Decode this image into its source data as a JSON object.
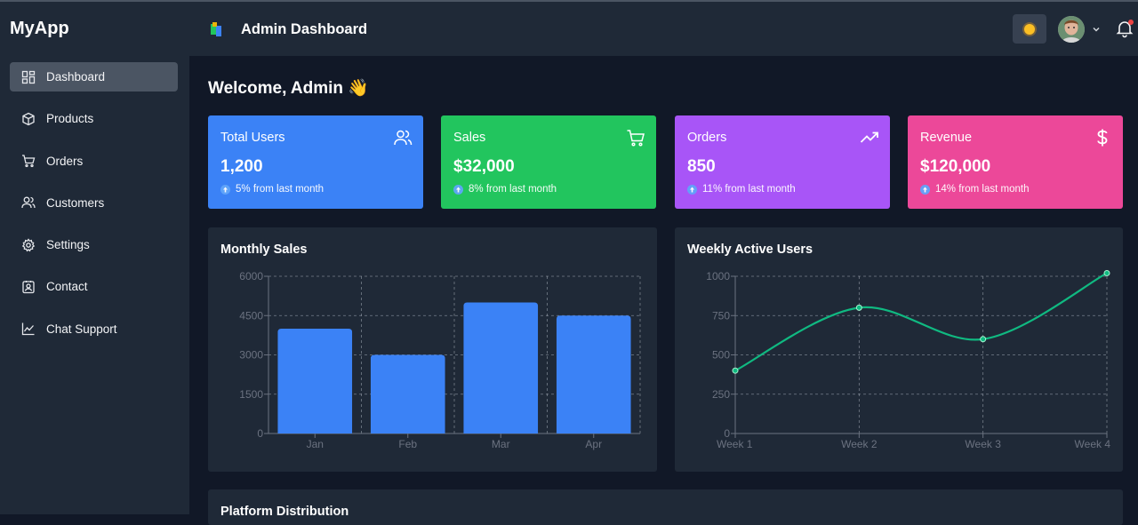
{
  "app": {
    "brand": "MyApp"
  },
  "sidebar": {
    "items": [
      {
        "label": "Dashboard",
        "icon": "dashboard-icon",
        "active": true
      },
      {
        "label": "Products",
        "icon": "box-icon"
      },
      {
        "label": "Orders",
        "icon": "cart-icon"
      },
      {
        "label": "Customers",
        "icon": "users-icon"
      },
      {
        "label": "Settings",
        "icon": "gear-icon"
      },
      {
        "label": "Contact",
        "icon": "contact-card-icon"
      },
      {
        "label": "Chat Support",
        "icon": "chart-line-icon"
      }
    ]
  },
  "header": {
    "title": "Admin Dashboard"
  },
  "main": {
    "welcome": "Welcome, Admin",
    "welcome_emoji": "👋",
    "stats": [
      {
        "title": "Total Users",
        "value": "1,200",
        "change": "5% from last month",
        "color": "#3b82f6",
        "icon": "users-icon"
      },
      {
        "title": "Sales",
        "value": "$32,000",
        "change": "8% from last month",
        "color": "#22c55e",
        "icon": "cart-icon"
      },
      {
        "title": "Orders",
        "value": "850",
        "change": "11% from last month",
        "color": "#a855f7",
        "icon": "trending-up-icon"
      },
      {
        "title": "Revenue",
        "value": "$120,000",
        "change": "14% from last month",
        "color": "#ec4899",
        "icon": "dollar-icon"
      }
    ],
    "bottom_panel_title": "Platform Distribution"
  },
  "chart_data": [
    {
      "type": "bar",
      "title": "Monthly Sales",
      "categories": [
        "Jan",
        "Feb",
        "Mar",
        "Apr"
      ],
      "values": [
        4000,
        3000,
        5000,
        4500
      ],
      "ylim": [
        0,
        6000
      ],
      "yticks": [
        0,
        1500,
        3000,
        4500,
        6000
      ],
      "color": "#3b82f6",
      "grid": true
    },
    {
      "type": "line",
      "title": "Weekly Active Users",
      "categories": [
        "Week 1",
        "Week 2",
        "Week 3",
        "Week 4"
      ],
      "values": [
        400,
        800,
        600,
        1020
      ],
      "ylim": [
        0,
        1000
      ],
      "yticks": [
        0,
        250,
        500,
        750,
        1000
      ],
      "color": "#10b981",
      "grid": true
    }
  ]
}
